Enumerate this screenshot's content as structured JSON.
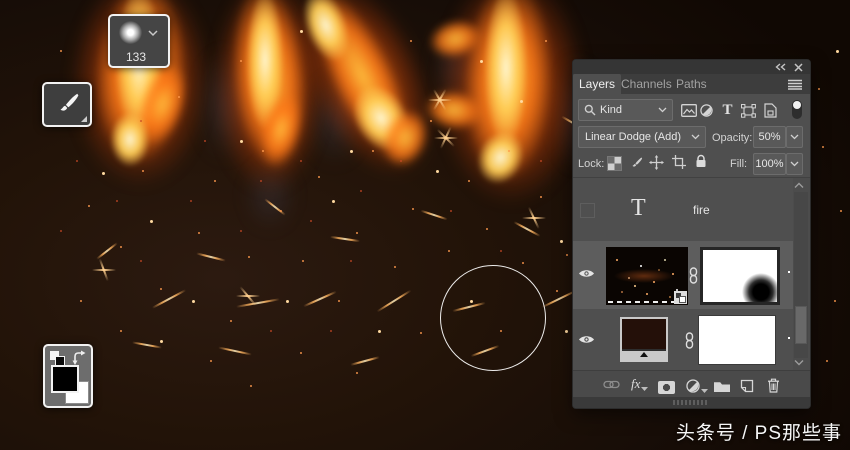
{
  "overlays": {
    "brush_preset": {
      "size_label": "133"
    },
    "watermark": "头条号 / PS那些事"
  },
  "layers_panel": {
    "tabs": [
      {
        "label": "Layers"
      },
      {
        "label": "Channels"
      },
      {
        "label": "Paths"
      }
    ],
    "filter_bar": {
      "search_field_label": "Kind",
      "type_filter_glyph": "T"
    },
    "blend_bar": {
      "blend_mode": "Linear Dodge (Add)",
      "opacity_label": "Opacity:",
      "opacity_value": "50%"
    },
    "lock_bar": {
      "lock_label": "Lock:",
      "fill_label": "Fill:",
      "fill_value": "100%"
    },
    "layers": [
      {
        "name": "fire",
        "type": "text",
        "visible": false,
        "thumb_glyph": "T"
      },
      {
        "name": "",
        "type": "image-with-mask",
        "visible": true,
        "selected": true
      },
      {
        "name": "",
        "type": "adjustment-with-mask",
        "visible": true
      }
    ],
    "footer": {
      "fx_label": "fx"
    }
  },
  "colors": {
    "canvas_background": "#1a0f08",
    "panel_background": "#4f4f4f",
    "panel_header": "#353535",
    "selected_row": "#5d5d5d",
    "flame_core": "#fff3c4",
    "flame_mid": "#ffb347",
    "flame_outer": "#e05a0d"
  }
}
